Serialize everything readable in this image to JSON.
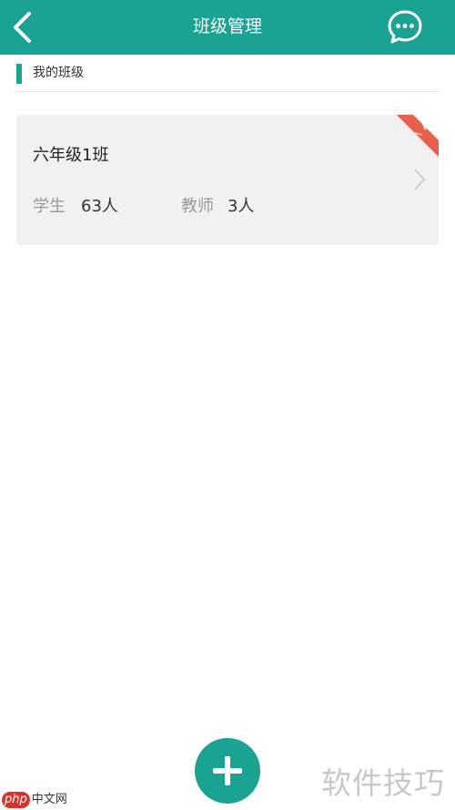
{
  "header": {
    "title": "班级管理",
    "back_icon": "chevron-left-icon",
    "message_icon": "chat-bubble-icon",
    "background": "#1aa293"
  },
  "section": {
    "title": "我的班级"
  },
  "class_card": {
    "name": "六年级1班",
    "students_label": "学生",
    "students_value": "63人",
    "teachers_label": "教师",
    "teachers_value": "3人",
    "ribbon_icon": "badge-ribbon-icon",
    "ribbon_color": "#e8604c"
  },
  "fab": {
    "icon": "plus-icon"
  },
  "watermark": {
    "text": "软件技巧"
  },
  "logo": {
    "mark": "php",
    "text": "中文网"
  }
}
